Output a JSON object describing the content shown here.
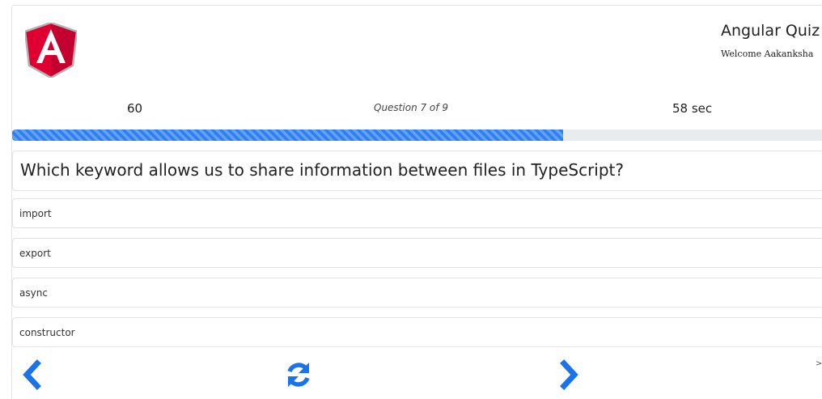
{
  "header": {
    "app_title": "Angular Quiz",
    "welcome_text": "Welcome Aakanksha",
    "logo_icon": "angular-logo-icon"
  },
  "status": {
    "score": "60",
    "question_counter": "Question 7 of 9",
    "timer": "58 sec"
  },
  "progress": {
    "percent": 68
  },
  "question": {
    "text": "Which keyword allows us to share information between files in TypeScript?"
  },
  "options": [
    {
      "label": "import"
    },
    {
      "label": "export"
    },
    {
      "label": "async"
    },
    {
      "label": "constructor"
    }
  ],
  "navigation": {
    "previous_icon": "chevron-left-icon",
    "refresh_icon": "refresh-icon",
    "next_icon": "chevron-right-icon",
    "more_indicator": ">"
  },
  "colors": {
    "accent": "#1a73e8",
    "angular_red": "#dd0031",
    "angular_dark_red": "#c3002f"
  }
}
